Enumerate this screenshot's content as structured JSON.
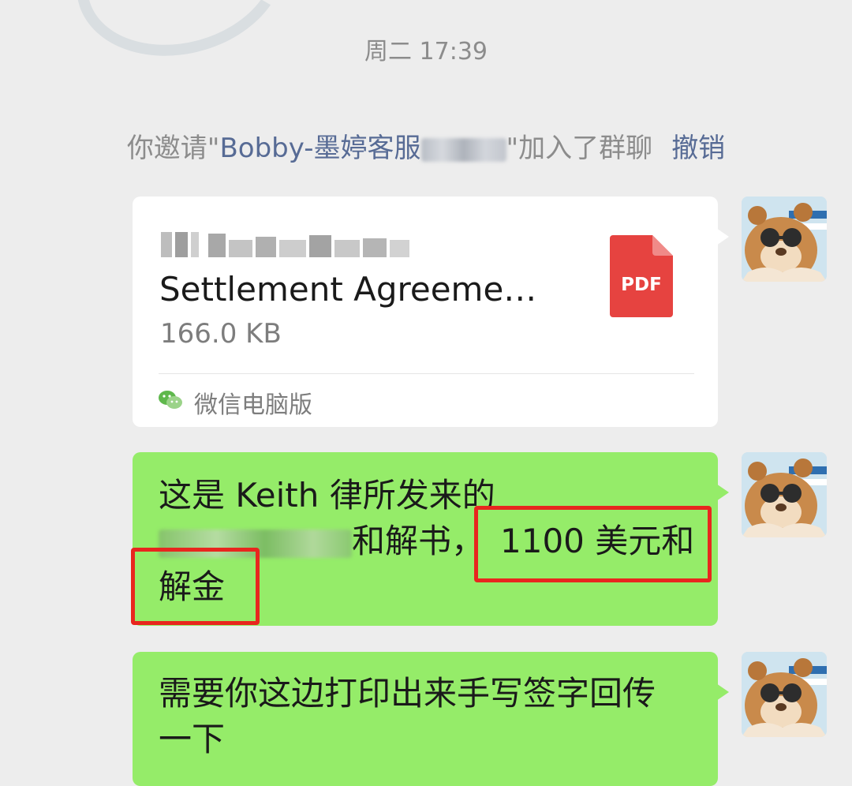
{
  "chat": {
    "timestamp": "周二 17:39",
    "system_message": {
      "prefix": "你邀请\"",
      "invitee_name": "Bobby-墨婷客服",
      "suffix": "\"加入了群聊",
      "revoke_link": "撤销"
    },
    "file_message": {
      "file_name": "Settlement Agreeme…",
      "file_size": "166.0 KB",
      "file_type_label": "PDF",
      "source_label": "微信电脑版",
      "icon": "pdf-file-icon",
      "source_icon": "wechat-icon"
    },
    "text_message_1": {
      "line_1": "这是 Keith 律所发来的",
      "line_2_suffix": "和解书，",
      "line_2_amount": "1100 美元和",
      "line_3": "解金"
    },
    "text_message_2": {
      "line_1": "需要你这边打印出来手写签字回传",
      "line_2": "一下"
    }
  },
  "colors": {
    "background": "#ededed",
    "incoming_bubble": "#ffffff",
    "outgoing_bubble": "#95ec69",
    "link_blue": "#576b95",
    "system_gray": "#8c8c8c",
    "pdf_red": "#e64340",
    "highlight_red": "#e8261e"
  }
}
